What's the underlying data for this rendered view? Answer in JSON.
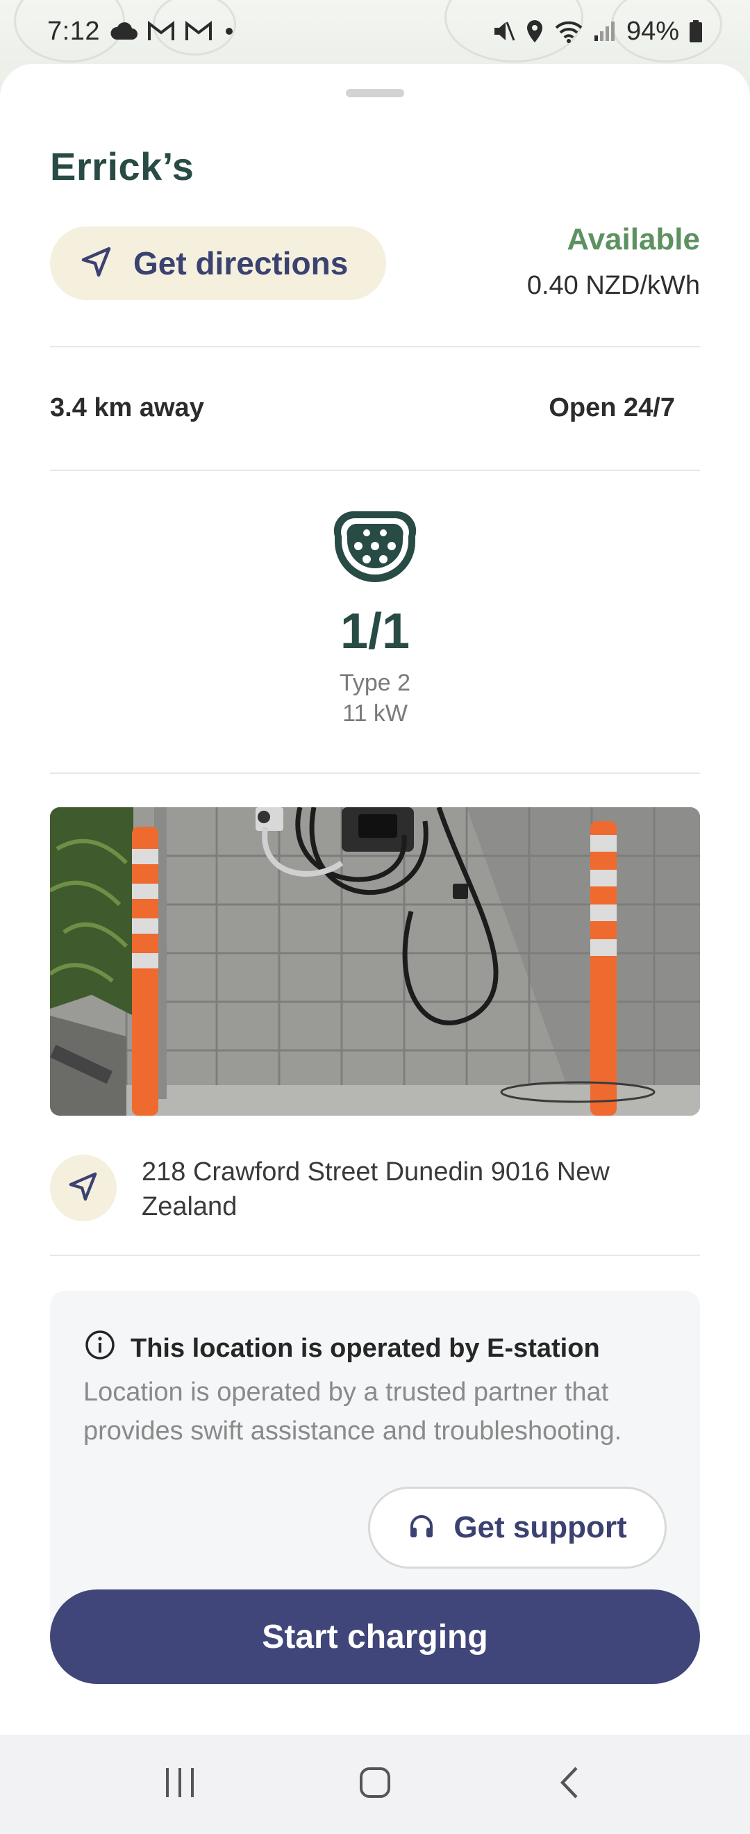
{
  "status_bar": {
    "time": "7:12",
    "battery": "94%",
    "icons_left": [
      "cloud-icon",
      "gmail-icon",
      "gmail-icon",
      "dot-icon"
    ],
    "icons_right": [
      "mute-icon",
      "location-icon",
      "wifi-icon",
      "signal-icon",
      "battery-icon"
    ]
  },
  "station": {
    "name": "Errick’s",
    "directions_label": "Get directions",
    "status": "Available",
    "price": "0.40 NZD/kWh",
    "distance": "3.4 km away",
    "hours": "Open 24/7"
  },
  "connector": {
    "icon": "type2-connector-icon",
    "count": "1/1",
    "type": "Type 2",
    "power": "11 kW"
  },
  "address": {
    "text": "218 Crawford Street Dunedin 9016 New Zealand"
  },
  "operator": {
    "title": "This location is operated by E-station",
    "description": "Location is operated by a trusted partner that provides swift assistance and troubleshooting.",
    "support_label": "Get support"
  },
  "actions": {
    "start_label": "Start charging"
  },
  "colors": {
    "brand_dark_green": "#284b45",
    "available_green": "#5c9160",
    "primary_button": "#40467a",
    "accent_cream": "#f5f0de"
  }
}
